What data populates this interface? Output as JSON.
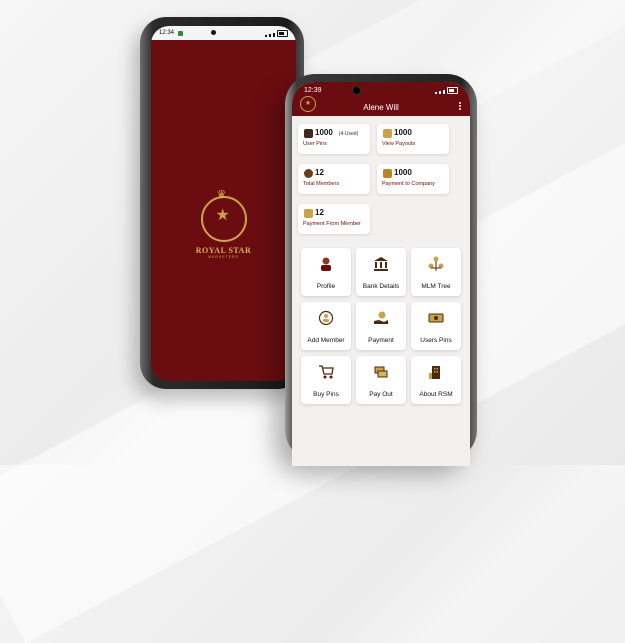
{
  "back_phone": {
    "status_time": "12:34",
    "brand_name": "ROYAL STAR",
    "brand_sub": "MARKETERS"
  },
  "front_phone": {
    "status_time": "12:39",
    "app_title": "Alene Will",
    "stats": [
      {
        "value": "1000",
        "extra": "(4-Used)",
        "label": "User Pins",
        "icon": "pin-card-icon"
      },
      {
        "value": "1000",
        "extra": "",
        "label": "View Payouts",
        "icon": "payout-icon"
      },
      {
        "value": "12",
        "extra": "",
        "label": "Total Members",
        "icon": "member-icon"
      },
      {
        "value": "1000",
        "extra": "",
        "label": "Payment to Company",
        "icon": "payment-icon"
      },
      {
        "value": "12",
        "extra": "",
        "label": "Payment From Member",
        "icon": "payment-from-icon"
      }
    ],
    "tiles": [
      {
        "label": "Profile",
        "icon": "profile-icon"
      },
      {
        "label": "Bank Details",
        "icon": "bank-icon"
      },
      {
        "label": "MLM Tree",
        "icon": "tree-icon"
      },
      {
        "label": "Add Member",
        "icon": "add-member-icon"
      },
      {
        "label": "Payment",
        "icon": "payment-hand-icon"
      },
      {
        "label": "Users Pins",
        "icon": "ticket-icon"
      },
      {
        "label": "Buy Pins",
        "icon": "cart-icon"
      },
      {
        "label": "Pay Out",
        "icon": "payout-cash-icon"
      },
      {
        "label": "About RSM",
        "icon": "building-icon"
      }
    ]
  },
  "colors": {
    "brand_maroon": "#6b0d10",
    "gold": "#c9a24a",
    "tile_bg": "#ffffff",
    "screen_bg": "#f3f1ef"
  }
}
